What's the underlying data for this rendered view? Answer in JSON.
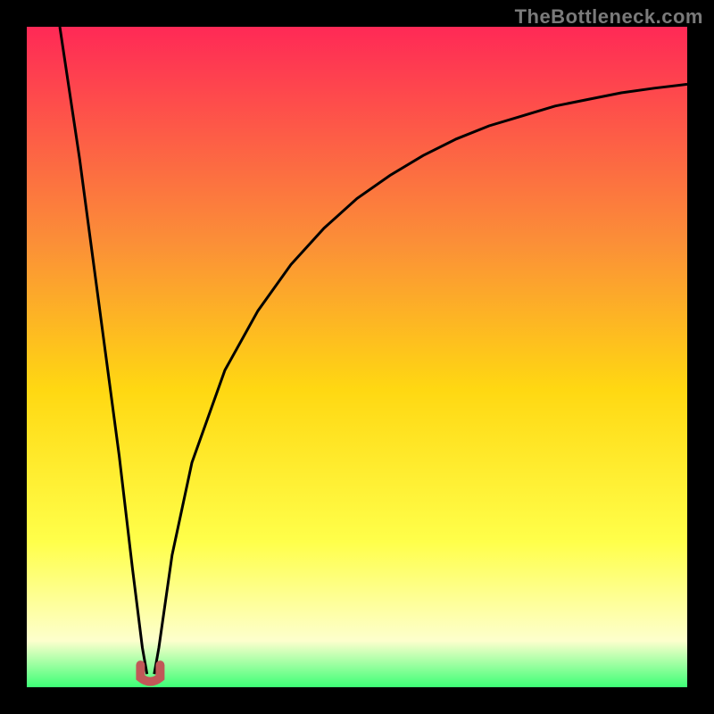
{
  "watermark": "TheBottleneck.com",
  "colors": {
    "gradient_top": "#ff2956",
    "gradient_q1": "#fb9037",
    "gradient_mid": "#ffd812",
    "gradient_q3": "#ffff4a",
    "gradient_q4": "#fdffcd",
    "gradient_bottom": "#3dff76",
    "frame": "#000000",
    "curve": "#000000",
    "marker": "#c15858"
  },
  "chart_data": {
    "type": "line",
    "title": "",
    "xlabel": "",
    "ylabel": "",
    "xlim": [
      0,
      100
    ],
    "ylim": [
      0,
      100
    ],
    "series": [
      {
        "name": "left-branch",
        "x": [
          5,
          8,
          10,
          12,
          14,
          16,
          17.5,
          18.2
        ],
        "values": [
          100,
          80,
          65,
          50,
          35,
          18,
          6,
          2
        ]
      },
      {
        "name": "right-branch",
        "x": [
          19.3,
          20,
          22,
          25,
          30,
          35,
          40,
          45,
          50,
          55,
          60,
          65,
          70,
          75,
          80,
          85,
          90,
          95,
          100
        ],
        "values": [
          2,
          6,
          20,
          34,
          48,
          57,
          64,
          69.5,
          74,
          77.5,
          80.5,
          83,
          85,
          86.5,
          88,
          89,
          90,
          90.7,
          91.3
        ]
      }
    ],
    "marker": {
      "name": "bottleneck-minimum",
      "x": 18.7,
      "y": 1.2,
      "shape": "u"
    },
    "bands": [
      {
        "name": "red",
        "y_from": 100,
        "y_to": 60
      },
      {
        "name": "orange",
        "y_from": 60,
        "y_to": 40
      },
      {
        "name": "yellow",
        "y_from": 40,
        "y_to": 22
      },
      {
        "name": "pale",
        "y_from": 22,
        "y_to": 10
      },
      {
        "name": "near-white",
        "y_from": 10,
        "y_to": 4
      },
      {
        "name": "green",
        "y_from": 4,
        "y_to": 0
      }
    ]
  }
}
